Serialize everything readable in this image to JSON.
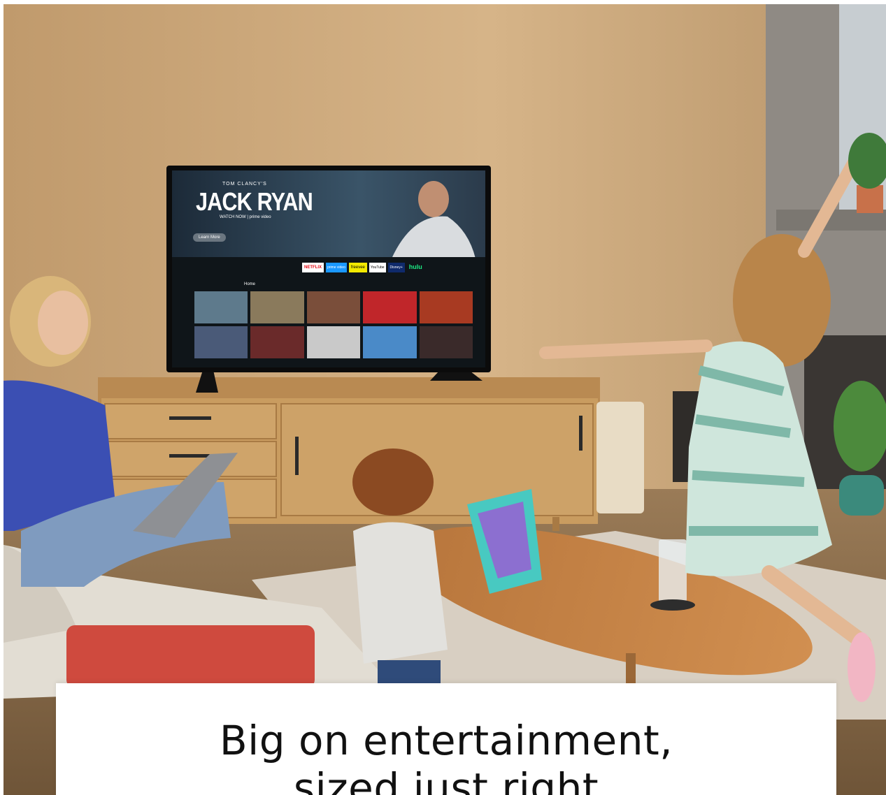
{
  "caption": {
    "line1": "Big on entertainment,",
    "line2": "sized just right"
  },
  "tv_screen": {
    "kicker": "TOM CLANCY'S",
    "title": "JACK RYAN",
    "watch_now": "WATCH NOW | prime video",
    "learn_more": "Learn More",
    "nav_home_label": "Home",
    "apps": [
      "NETFLIX",
      "prime video",
      "freevee",
      "YouTube",
      "Disney+",
      "hulu"
    ]
  },
  "colors": {
    "wall": "#c9a679",
    "floor": "#8a6a4a",
    "credenza": "#c89a5e",
    "sofa": "#e6e1d8",
    "blanket": "#d1463c",
    "card_bg": "#ffffff",
    "caption_text": "#111111"
  }
}
